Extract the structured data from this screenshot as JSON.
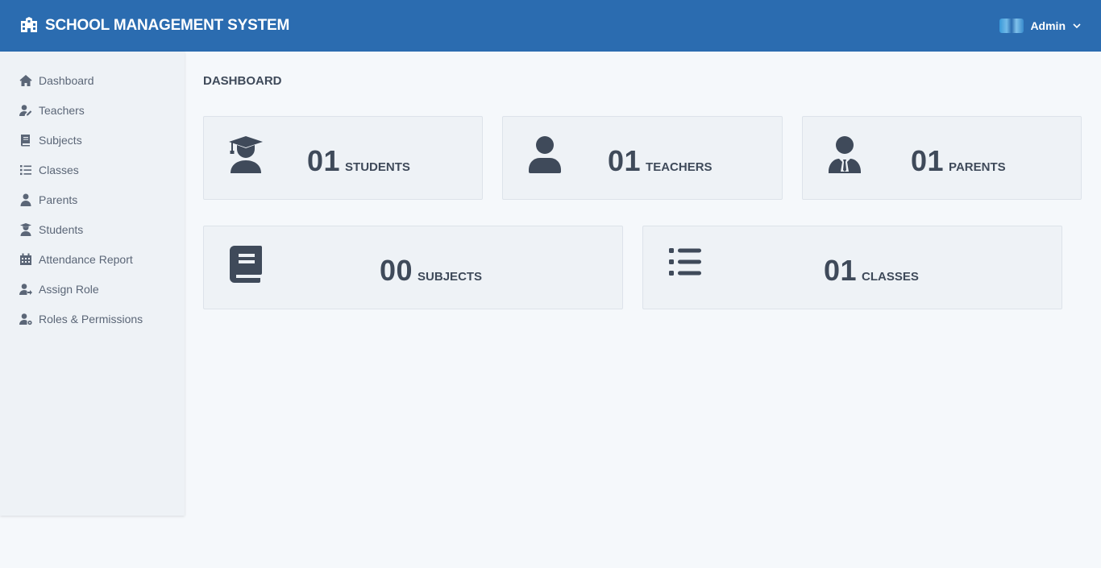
{
  "header": {
    "title": "SCHOOL MANAGEMENT SYSTEM",
    "user_name": "Admin"
  },
  "sidebar": {
    "items": [
      {
        "label": "Dashboard",
        "icon": "home-icon"
      },
      {
        "label": "Teachers",
        "icon": "user-edit-icon"
      },
      {
        "label": "Subjects",
        "icon": "book-icon"
      },
      {
        "label": "Classes",
        "icon": "list-icon"
      },
      {
        "label": "Parents",
        "icon": "user-tie-icon"
      },
      {
        "label": "Students",
        "icon": "user-graduate-icon"
      },
      {
        "label": "Attendance Report",
        "icon": "calendar-icon"
      },
      {
        "label": "Assign Role",
        "icon": "user-arrow-icon"
      },
      {
        "label": "Roles & Permissions",
        "icon": "user-gear-icon"
      }
    ]
  },
  "main": {
    "title": "DASHBOARD",
    "cards": [
      {
        "count": "01",
        "label": "STUDENTS",
        "icon": "user-graduate-icon"
      },
      {
        "count": "01",
        "label": "TEACHERS",
        "icon": "user-icon"
      },
      {
        "count": "01",
        "label": "PARENTS",
        "icon": "user-tie-icon"
      },
      {
        "count": "00",
        "label": "SUBJECTS",
        "icon": "book-icon"
      },
      {
        "count": "01",
        "label": "CLASSES",
        "icon": "list-icon"
      }
    ]
  },
  "colors": {
    "header_bg": "#2b6cb0",
    "sidebar_bg": "#eef2f6",
    "page_bg": "#f5f8fb",
    "card_bg": "#eef2f6",
    "text": "#3f4a5a"
  }
}
